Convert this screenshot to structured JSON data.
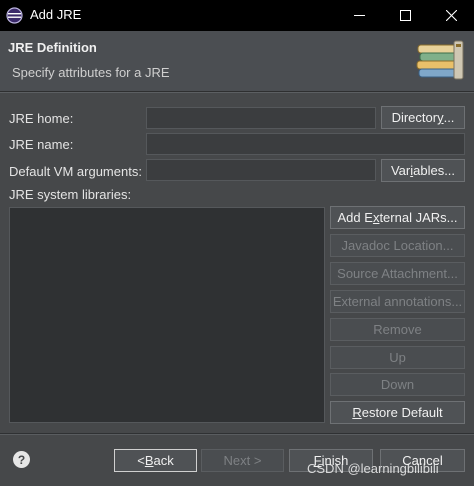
{
  "window": {
    "title": "Add JRE",
    "minimize_icon": "minimize-icon",
    "maximize_icon": "maximize-icon",
    "close_icon": "close-icon"
  },
  "header": {
    "title": "JRE Definition",
    "subtitle": "Specify attributes for a JRE",
    "banner_icon": "books-icon"
  },
  "form": {
    "jre_home_label": "JRE home:",
    "jre_home_value": "",
    "directory_button": {
      "before": "Director",
      "mnemonic": "y",
      "after": "..."
    },
    "jre_name_label": "JRE name:",
    "jre_name_value": "",
    "vm_args_label": "Default VM arguments:",
    "vm_args_value": "",
    "variables_button": {
      "before": "Var",
      "mnemonic": "i",
      "after": "ables..."
    },
    "libraries_label": "JRE system libraries:"
  },
  "library_buttons": {
    "add_external": {
      "before": "Add E",
      "mnemonic": "x",
      "after": "ternal JARs..."
    },
    "javadoc": "Javadoc Location...",
    "source": "Source Attachment...",
    "annotations": "External annotations...",
    "remove": "Remove",
    "up": "Up",
    "down": "Down",
    "restore": {
      "before": "",
      "mnemonic": "R",
      "after": "estore Default"
    }
  },
  "footer": {
    "help_icon": "help-icon",
    "back": {
      "before": "< ",
      "mnemonic": "B",
      "after": "ack"
    },
    "next": "Next >",
    "finish": {
      "before": "",
      "mnemonic": "F",
      "after": "inish"
    },
    "cancel": "Cancel"
  },
  "watermark": "CSDN @learningbilibili",
  "colors": {
    "background": "#46484a",
    "titlebar": "#000000",
    "text": "#e2e2e2",
    "disabled_text": "#7e8184"
  }
}
